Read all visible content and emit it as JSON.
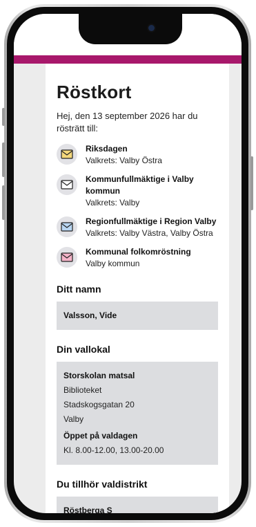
{
  "page": {
    "title": "Röstkort",
    "intro": "Hej, den 13 september 2026 har du rösträtt till:"
  },
  "elections": [
    {
      "title": "Riksdagen",
      "district": "Valkrets: Valby Östra",
      "icon": "envelope-icon",
      "color": "#f3d77b"
    },
    {
      "title": "Kommunfullmäktige i Valby kommun",
      "district": "Valkrets: Valby",
      "icon": "envelope-icon",
      "color": "#ffffff"
    },
    {
      "title": "Regionfullmäktige i Region Valby",
      "district": "Valkrets: Valby Västra, Valby Östra",
      "icon": "envelope-icon",
      "color": "#b9d6f2"
    },
    {
      "title": "Kommunal folkomröstning",
      "district": "Valby kommun",
      "icon": "envelope-icon",
      "color": "#f4b3c8"
    }
  ],
  "name_section": {
    "heading": "Ditt namn",
    "value": "Valsson, Vide"
  },
  "polling_section": {
    "heading": "Din vallokal",
    "place": "Storskolan matsal",
    "line1": "Biblioteket",
    "line2": "Stadskogsgatan 20",
    "line3": "Valby",
    "hours_heading": "Öppet på valdagen",
    "hours": "Kl. 8.00-12.00, 13.00-20.00"
  },
  "district_section": {
    "heading": "Du tillhör valdistrikt",
    "value": "Röstberga S"
  },
  "colors": {
    "accent": "#a8186b"
  }
}
